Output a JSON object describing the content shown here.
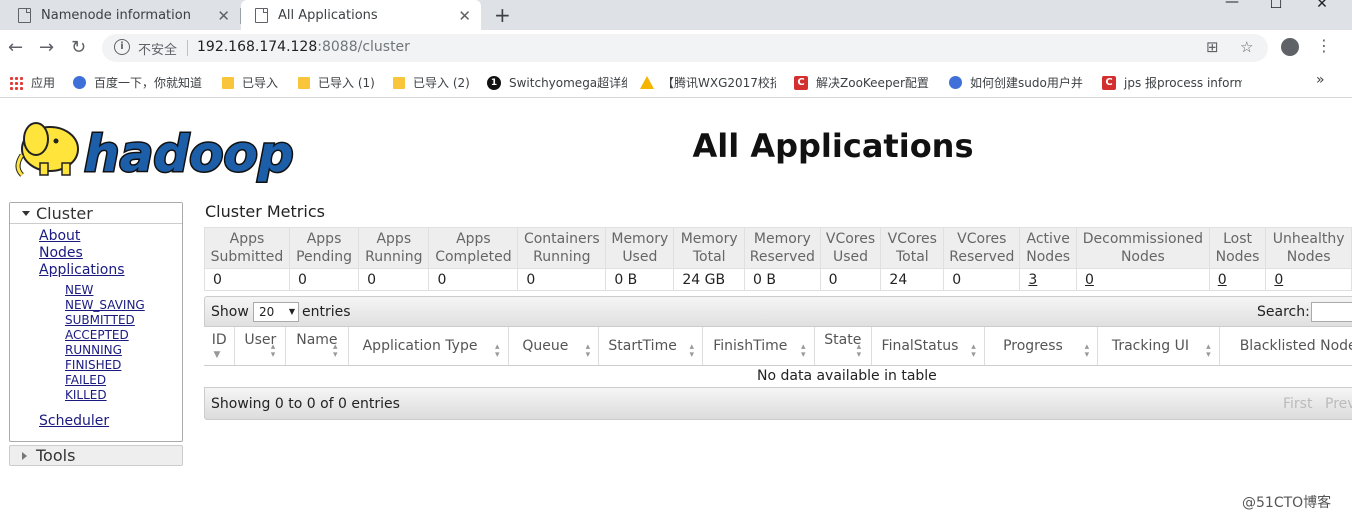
{
  "browser": {
    "tabs": [
      {
        "title": "Namenode information",
        "active": false
      },
      {
        "title": "All Applications",
        "active": true
      }
    ],
    "url_security": "不安全",
    "url_host": "192.168.174.128",
    "url_path": ":8088/cluster",
    "bookmarks": [
      {
        "label": "应用",
        "icon": "apps-grid-icon"
      },
      {
        "label": "百度一下，你就知道",
        "icon": "baidu-paw-icon"
      },
      {
        "label": "已导入",
        "icon": "folder-icon"
      },
      {
        "label": "已导入 (1)",
        "icon": "folder-icon"
      },
      {
        "label": "已导入 (2)",
        "icon": "folder-icon"
      },
      {
        "label": "Switchyomega超详细",
        "icon": "switchy-icon"
      },
      {
        "label": "【腾讯WXG2017校招",
        "icon": "warning-triangle-icon"
      },
      {
        "label": "解决ZooKeeper配置",
        "icon": "csdn-icon"
      },
      {
        "label": "如何创建sudo用户并",
        "icon": "baidu-paw-icon"
      },
      {
        "label": "jps 报process inform",
        "icon": "csdn-icon"
      }
    ]
  },
  "page": {
    "title": "All Applications",
    "logo_text": "hadoop"
  },
  "sidebar": {
    "cluster_label": "Cluster",
    "links": [
      "About",
      "Nodes",
      "Applications"
    ],
    "states": [
      "NEW",
      "NEW_SAVING",
      "SUBMITTED",
      "ACCEPTED",
      "RUNNING",
      "FINISHED",
      "FAILED",
      "KILLED"
    ],
    "scheduler": "Scheduler",
    "tools_label": "Tools"
  },
  "metrics": {
    "title": "Cluster Metrics",
    "headers": [
      [
        "Apps",
        "Submitted"
      ],
      [
        "Apps",
        "Pending"
      ],
      [
        "Apps",
        "Running"
      ],
      [
        "Apps",
        "Completed"
      ],
      [
        "Containers",
        "Running"
      ],
      [
        "Memory",
        "Used"
      ],
      [
        "Memory",
        "Total"
      ],
      [
        "Memory",
        "Reserved"
      ],
      [
        "VCores",
        "Used"
      ],
      [
        "VCores",
        "Total"
      ],
      [
        "VCores",
        "Reserved"
      ],
      [
        "Active",
        "Nodes"
      ],
      [
        "Decommissioned",
        "Nodes"
      ],
      [
        "Lost",
        "Nodes"
      ],
      [
        "Unhealthy",
        "Nodes"
      ]
    ],
    "values": [
      "0",
      "0",
      "0",
      "0",
      "0",
      "0 B",
      "24 GB",
      "0 B",
      "0",
      "24",
      "0",
      "3",
      "0",
      "0",
      "0"
    ]
  },
  "apps_table": {
    "show_label": "Show",
    "page_length": "20",
    "entries_label": "entries",
    "search_label": "Search:",
    "columns": [
      "ID",
      "User",
      "Name",
      "Application Type",
      "Queue",
      "StartTime",
      "FinishTime",
      "State",
      "FinalStatus",
      "Progress",
      "Tracking UI",
      "Blacklisted Nodes"
    ],
    "empty_message": "No data available in table",
    "info": "Showing 0 to 0 of 0 entries",
    "pager_first": "First",
    "pager_previous": "Previous"
  },
  "watermark": "@51CTO博客"
}
